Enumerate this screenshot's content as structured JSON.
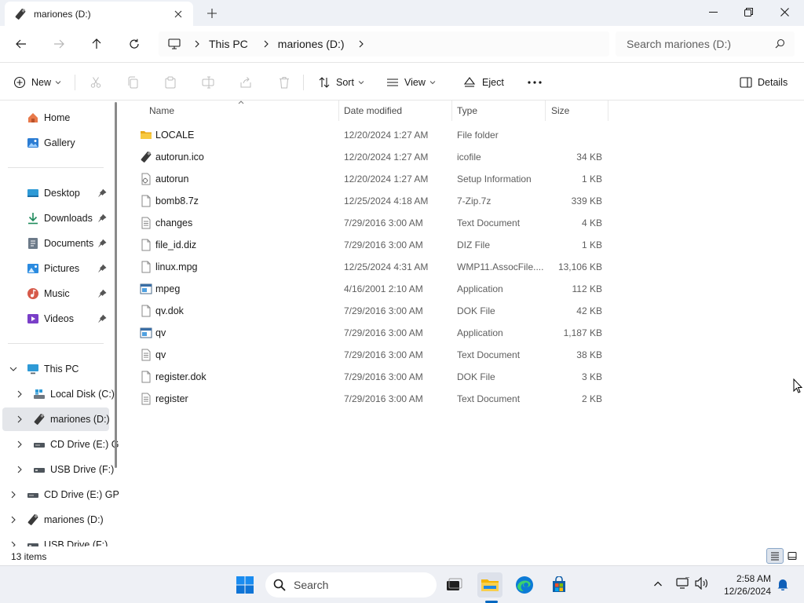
{
  "tab": {
    "title": "mariones (D:)"
  },
  "address": {
    "breadcrumbs": [
      "This PC",
      "mariones (D:)"
    ]
  },
  "search": {
    "placeholder": "Search mariones (D:)"
  },
  "toolbar": {
    "new_label": "New",
    "sort_label": "Sort",
    "view_label": "View",
    "eject_label": "Eject",
    "details_label": "Details"
  },
  "sidebar": {
    "items": [
      {
        "label": "Home",
        "icon": "home-icon"
      },
      {
        "label": "Gallery",
        "icon": "gallery-icon"
      },
      {
        "label": "Desktop",
        "icon": "desktop-icon",
        "pinned": true
      },
      {
        "label": "Downloads",
        "icon": "download-icon",
        "pinned": true
      },
      {
        "label": "Documents",
        "icon": "documents-icon",
        "pinned": true
      },
      {
        "label": "Pictures",
        "icon": "pictures-icon",
        "pinned": true
      },
      {
        "label": "Music",
        "icon": "music-icon",
        "pinned": true
      },
      {
        "label": "Videos",
        "icon": "videos-icon",
        "pinned": true
      },
      {
        "label": "This PC",
        "icon": "computer-icon"
      },
      {
        "label": "Local Disk (C:)",
        "icon": "drive-icon"
      },
      {
        "label": "mariones (D:)",
        "icon": "usb-drive-icon",
        "selected": true
      },
      {
        "label": "CD Drive (E:) G",
        "icon": "cd-drive-icon"
      },
      {
        "label": "USB Drive (F:)",
        "icon": "usb-drive-icon"
      },
      {
        "label": "CD Drive (E:) GP",
        "icon": "cd-drive-icon"
      },
      {
        "label": "mariones (D:)",
        "icon": "usb-drive-icon"
      },
      {
        "label": "USB Drive (F:)",
        "icon": "usb-drive-icon"
      }
    ]
  },
  "columns": {
    "name": "Name",
    "date": "Date modified",
    "type": "Type",
    "size": "Size"
  },
  "files": [
    {
      "name": "LOCALE",
      "date": "12/20/2024 1:27 AM",
      "type": "File folder",
      "size": "",
      "icon": "folder-icon"
    },
    {
      "name": "autorun.ico",
      "date": "12/20/2024 1:27 AM",
      "type": "icofile",
      "size": "34 KB",
      "icon": "usb-drive-icon"
    },
    {
      "name": "autorun",
      "date": "12/20/2024 1:27 AM",
      "type": "Setup Information",
      "size": "1 KB",
      "icon": "settings-file-icon"
    },
    {
      "name": "bomb8.7z",
      "date": "12/25/2024 4:18 AM",
      "type": "7-Zip.7z",
      "size": "339 KB",
      "icon": "file-icon"
    },
    {
      "name": "changes",
      "date": "7/29/2016 3:00 AM",
      "type": "Text Document",
      "size": "4 KB",
      "icon": "text-file-icon"
    },
    {
      "name": "file_id.diz",
      "date": "7/29/2016 3:00 AM",
      "type": "DIZ File",
      "size": "1 KB",
      "icon": "file-icon"
    },
    {
      "name": "linux.mpg",
      "date": "12/25/2024 4:31 AM",
      "type": "WMP11.AssocFile....",
      "size": "13,106 KB",
      "icon": "file-icon"
    },
    {
      "name": "mpeg",
      "date": "4/16/2001 2:10 AM",
      "type": "Application",
      "size": "112 KB",
      "icon": "application-icon"
    },
    {
      "name": "qv.dok",
      "date": "7/29/2016 3:00 AM",
      "type": "DOK File",
      "size": "42 KB",
      "icon": "file-icon"
    },
    {
      "name": "qv",
      "date": "7/29/2016 3:00 AM",
      "type": "Application",
      "size": "1,187 KB",
      "icon": "application-icon"
    },
    {
      "name": "qv",
      "date": "7/29/2016 3:00 AM",
      "type": "Text Document",
      "size": "38 KB",
      "icon": "text-file-icon"
    },
    {
      "name": "register.dok",
      "date": "7/29/2016 3:00 AM",
      "type": "DOK File",
      "size": "3 KB",
      "icon": "file-icon"
    },
    {
      "name": "register",
      "date": "7/29/2016 3:00 AM",
      "type": "Text Document",
      "size": "2 KB",
      "icon": "text-file-icon"
    }
  ],
  "status": {
    "item_count": "13 items"
  },
  "taskbar": {
    "search_label": "Search",
    "time": "2:58 AM",
    "date": "12/26/2024"
  },
  "colors": {
    "accent": "#0067c0",
    "folder": "#f4c441",
    "selected_bg": "#e4e6ea"
  }
}
